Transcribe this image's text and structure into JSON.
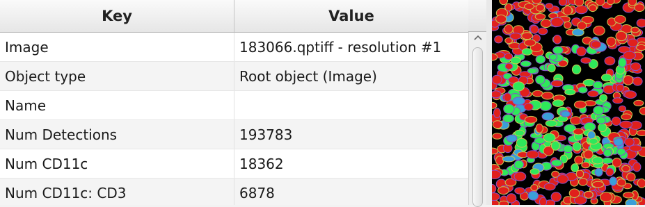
{
  "table": {
    "headers": {
      "key": "Key",
      "value": "Value"
    },
    "rows": [
      {
        "key": "Image",
        "value": "183066.qptiff - resolution #1"
      },
      {
        "key": "Object type",
        "value": "Root object (Image)"
      },
      {
        "key": "Name",
        "value": ""
      },
      {
        "key": "Num Detections",
        "value": "193783"
      },
      {
        "key": "Num CD11c",
        "value": "18362"
      },
      {
        "key": "Num CD11c: CD3",
        "value": "6878"
      }
    ]
  },
  "icons": {
    "scroll_up": "chevron-up-icon"
  },
  "viewer": {
    "colors": {
      "background": "#000000",
      "cell_red": "#e0201c",
      "cell_green": "#2ee85a",
      "cell_blue": "#3a9fd8",
      "outline_yellow": "#c8c850",
      "outline_purple": "#8a4fc8"
    }
  }
}
